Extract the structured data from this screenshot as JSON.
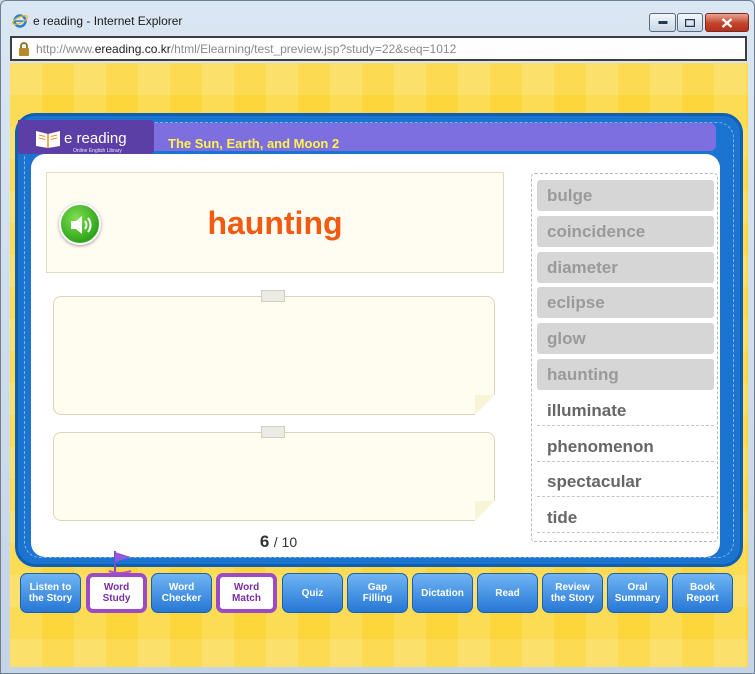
{
  "window": {
    "title": "e reading - Internet Explorer"
  },
  "address": {
    "prefix": "http://www.",
    "domain": "ereading.co.kr",
    "path": "/html/Elearning/test_preview.jsp?study=22&seq=1012"
  },
  "header": {
    "logo_text": "reading",
    "logo_sub": "Online English Library",
    "story_title": "The Sun, Earth, and Moon 2"
  },
  "card": {
    "word": "haunting"
  },
  "progress": {
    "current": "6",
    "total": "/ 10"
  },
  "word_list": [
    {
      "label": "bulge",
      "used": true
    },
    {
      "label": "coincidence",
      "used": true
    },
    {
      "label": "diameter",
      "used": true
    },
    {
      "label": "eclipse",
      "used": true
    },
    {
      "label": "glow",
      "used": true
    },
    {
      "label": "haunting",
      "used": true
    },
    {
      "label": "illuminate",
      "used": false
    },
    {
      "label": "phenomenon",
      "used": false
    },
    {
      "label": "spectacular",
      "used": false
    },
    {
      "label": "tide",
      "used": false
    }
  ],
  "nav": [
    {
      "line1": "Listen to",
      "line2": "the Story",
      "active": false
    },
    {
      "line1": "Word",
      "line2": "Study",
      "active": true
    },
    {
      "line1": "Word",
      "line2": "Checker",
      "active": false
    },
    {
      "line1": "Word",
      "line2": "Match",
      "active": true
    },
    {
      "line1": "Quiz",
      "line2": "",
      "active": false
    },
    {
      "line1": "Gap",
      "line2": "Filling",
      "active": false
    },
    {
      "line1": "Dictation",
      "line2": "",
      "active": false
    },
    {
      "line1": "Read",
      "line2": "",
      "active": false
    },
    {
      "line1": "Review",
      "line2": "the Story",
      "active": false
    },
    {
      "line1": "Oral",
      "line2": "Summary",
      "active": false
    },
    {
      "line1": "Book",
      "line2": "Report",
      "active": false
    }
  ],
  "colors": {
    "word": "#f25a12",
    "board": "#1c74d1",
    "header": "#7e6fe0",
    "title": "#fff34d",
    "active_nav": "#9c4ac6"
  }
}
